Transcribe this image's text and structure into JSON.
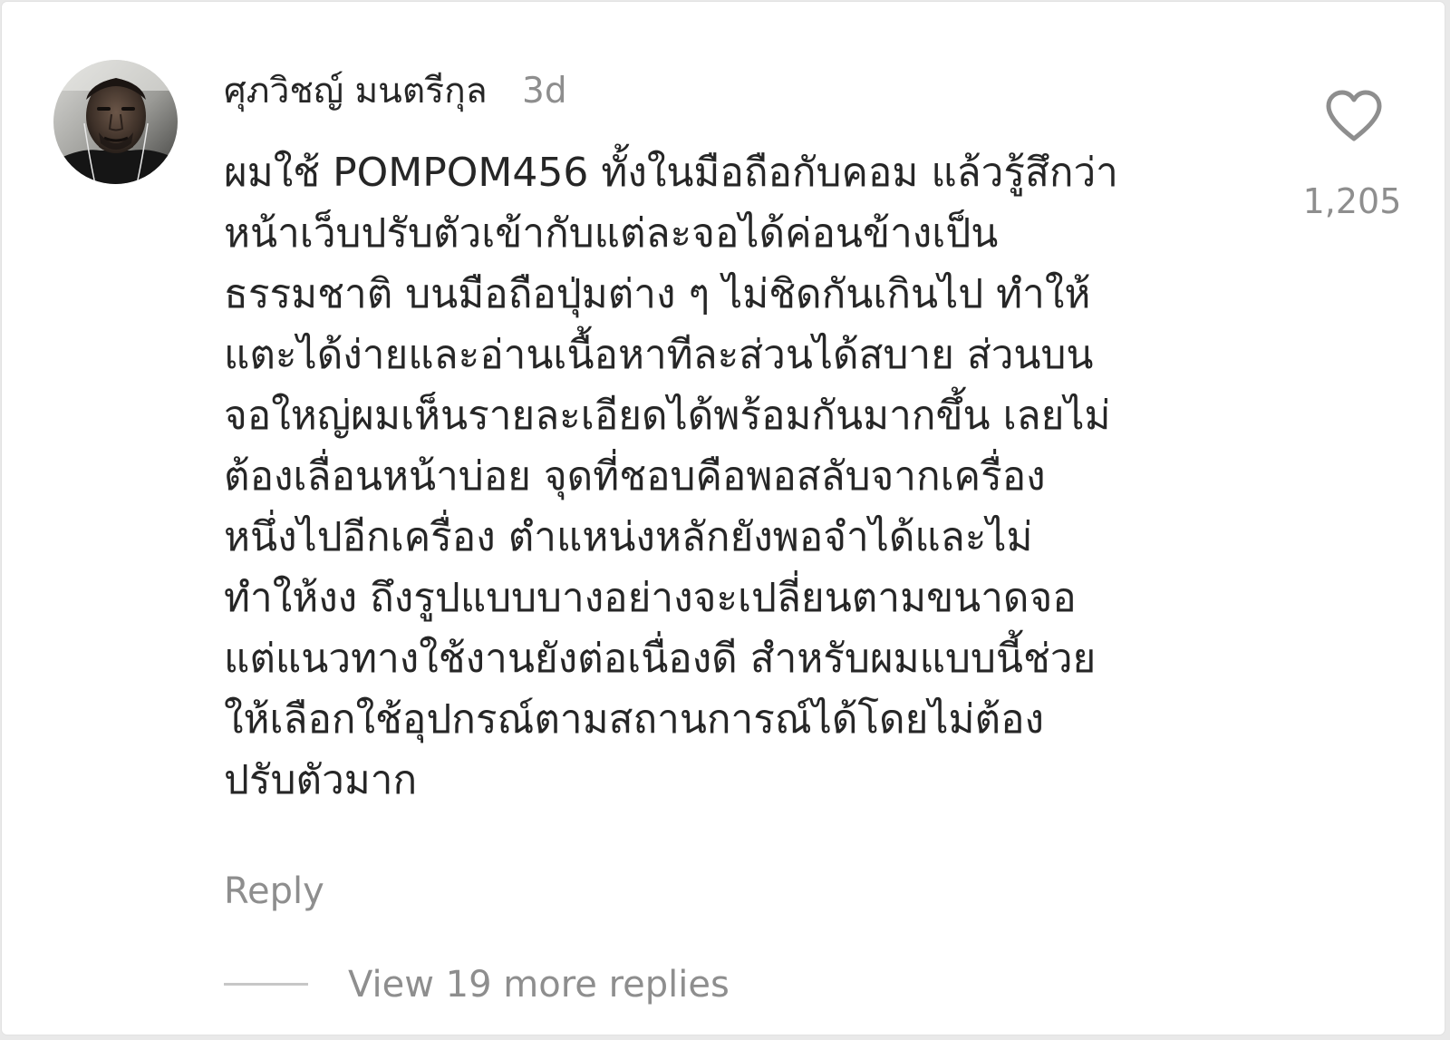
{
  "comment": {
    "avatar_icon": "user-avatar-photo",
    "username": "ศุภวิชญ์ มนตรีกุล",
    "timestamp": "3d",
    "text": "ผมใช้ POMPOM456 ทั้งในมือถือกับคอม แล้วรู้สึกว่า\nหน้าเว็บปรับตัวเข้ากับแต่ละจอได้ค่อนข้างเป็น\nธรรมชาติ บนมือถือปุ่มต่าง ๆ ไม่ชิดกันเกินไป ทำให้\nแตะได้ง่ายและอ่านเนื้อหาทีละส่วนได้สบาย ส่วนบน\nจอใหญ่ผมเห็นรายละเอียดได้พร้อมกันมากขึ้น เลยไม่\nต้องเลื่อนหน้าบ่อย จุดที่ชอบคือพอสลับจากเครื่อง\nหนึ่งไปอีกเครื่อง ตำแหน่งหลักยังพอจำได้และไม่\nทำให้งง ถึงรูปแบบบางอย่างจะเปลี่ยนตามขนาดจอ\nแต่แนวทางใช้งานยังต่อเนื่องดี สำหรับผมแบบนี้ช่วย\nให้เลือกใช้อุปกรณ์ตามสถานการณ์ได้โดยไม่ต้อง\nปรับตัวมาก",
    "like_icon": "heart-outline-icon",
    "like_count": "1,205",
    "reply_label": "Reply",
    "view_replies_label": "View 19 more replies"
  },
  "colors": {
    "primary_text": "#262626",
    "secondary_text": "#8e8e8e",
    "divider": "#c7c7c7",
    "background": "#ffffff"
  }
}
